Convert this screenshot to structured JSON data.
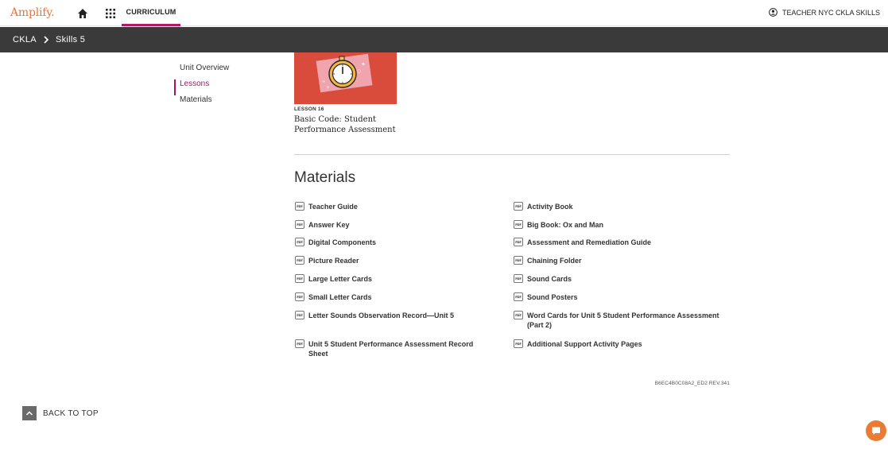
{
  "header": {
    "logo": "Amplify.",
    "nav_curriculum": "CURRICULUM",
    "user_label": "TEACHER NYC CKLA SKILLS",
    "icons": [
      "home-icon",
      "apps-grid-icon",
      "user-circle-icon"
    ]
  },
  "breadcrumb": {
    "items": [
      "CKLA",
      "Skills 5"
    ]
  },
  "sidebar": {
    "items": [
      {
        "label": "Unit Overview",
        "active": false
      },
      {
        "label": "Lessons",
        "active": true
      },
      {
        "label": "Materials",
        "active": false
      }
    ]
  },
  "lesson": {
    "label": "LESSON 16",
    "title": "Basic Code: Student Performance Assessment",
    "image_icon": "stopwatch-icon"
  },
  "materials": {
    "heading": "Materials",
    "left": [
      "Teacher Guide",
      "Answer Key",
      "Digital Components",
      "Picture Reader",
      "Large Letter Cards",
      "Small Letter Cards",
      "Letter Sounds Observation Record—Unit 5",
      "Unit 5 Student Performance Assessment Record Sheet"
    ],
    "right": [
      "Activity Book",
      "Big Book: Ox and Man",
      "Assessment and Remediation Guide",
      "Chaining Folder",
      "Sound Cards",
      "Sound Posters",
      "Word Cards for Unit 5 Student Performance Assessment (Part 2)",
      "Additional Support Activity Pages"
    ]
  },
  "revision": "B6EC4B0C08A2_ED2 REV.341",
  "back_to_top": "BACK TO TOP",
  "colors": {
    "brand_orange": "#e8743b",
    "accent_magenta": "#a3155e",
    "breadcrumb_bg": "#3a3a3a",
    "lesson_image_bg": "#d94b3a",
    "chat_orange": "#ea7b33"
  }
}
